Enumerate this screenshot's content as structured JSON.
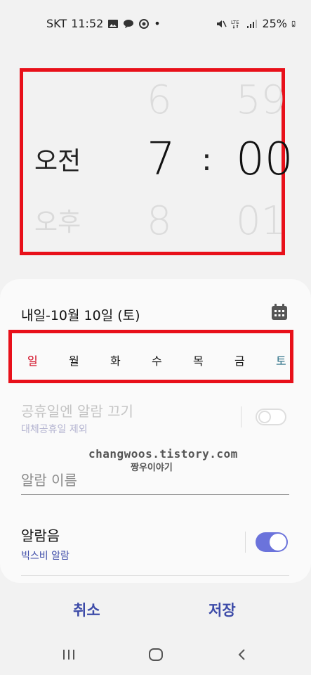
{
  "status": {
    "carrier": "SKT",
    "time": "11:52",
    "dot": "•",
    "battery": "25%",
    "icons_left": [
      "image-icon",
      "chat-icon",
      "location-face-icon"
    ],
    "icons_right": [
      "mute-icon",
      "lte-icon",
      "signal-icon",
      "battery-icon"
    ]
  },
  "picker": {
    "ampm_selected": "오전",
    "ampm_other": "오후",
    "hour_prev": "6",
    "hour": "7",
    "hour_next": "8",
    "colon": ":",
    "minute_prev": "59",
    "minute": "00",
    "minute_next": "01"
  },
  "date_text": "내일-10월 10일 (토)",
  "days": [
    {
      "label": "일",
      "color": "#d0021b"
    },
    {
      "label": "월",
      "color": "#111111"
    },
    {
      "label": "화",
      "color": "#111111"
    },
    {
      "label": "수",
      "color": "#111111"
    },
    {
      "label": "목",
      "color": "#111111"
    },
    {
      "label": "금",
      "color": "#111111"
    },
    {
      "label": "토",
      "color": "#2a6f86"
    }
  ],
  "holiday": {
    "title": "공휴일엔 알람 끄기",
    "subtitle": "대체공휴일 제외",
    "enabled": false
  },
  "watermark": {
    "line1": "changwoos.tistory.com",
    "line2": "짱우이야기"
  },
  "alarm_name": {
    "placeholder": "알람 이름",
    "value": ""
  },
  "sound": {
    "title": "알람음",
    "subtitle": "빅스비 알람",
    "enabled": true
  },
  "buttons": {
    "cancel": "취소",
    "save": "저장"
  },
  "colors": {
    "accent": "#3d4ba8",
    "toggle_on": "#6b73db",
    "highlight_box": "#e8101a"
  },
  "nav": [
    "recent-apps-icon",
    "home-icon",
    "back-icon"
  ]
}
